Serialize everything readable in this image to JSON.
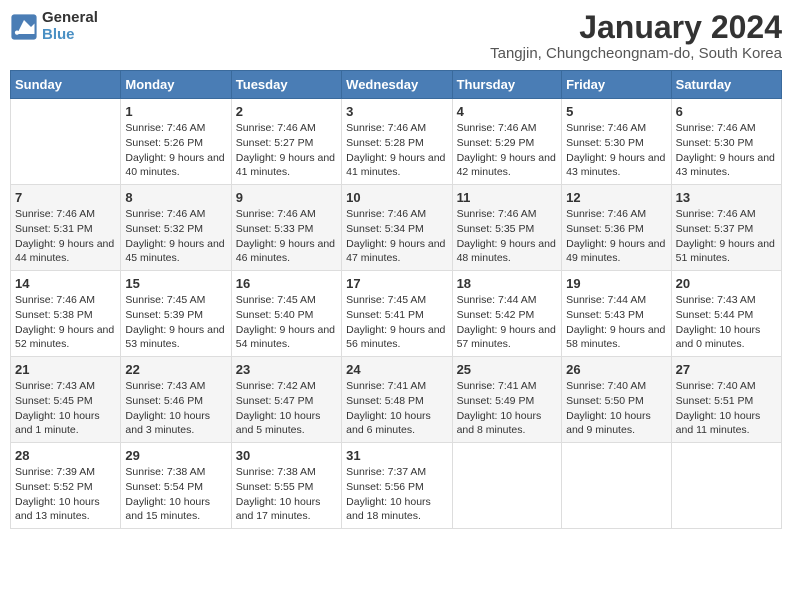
{
  "header": {
    "logo_line1": "General",
    "logo_line2": "Blue",
    "main_title": "January 2024",
    "subtitle": "Tangjin, Chungcheongnam-do, South Korea"
  },
  "days_of_week": [
    "Sunday",
    "Monday",
    "Tuesday",
    "Wednesday",
    "Thursday",
    "Friday",
    "Saturday"
  ],
  "weeks": [
    [
      {
        "day": "",
        "sunrise": "",
        "sunset": "",
        "daylight": ""
      },
      {
        "day": "1",
        "sunrise": "Sunrise: 7:46 AM",
        "sunset": "Sunset: 5:26 PM",
        "daylight": "Daylight: 9 hours and 40 minutes."
      },
      {
        "day": "2",
        "sunrise": "Sunrise: 7:46 AM",
        "sunset": "Sunset: 5:27 PM",
        "daylight": "Daylight: 9 hours and 41 minutes."
      },
      {
        "day": "3",
        "sunrise": "Sunrise: 7:46 AM",
        "sunset": "Sunset: 5:28 PM",
        "daylight": "Daylight: 9 hours and 41 minutes."
      },
      {
        "day": "4",
        "sunrise": "Sunrise: 7:46 AM",
        "sunset": "Sunset: 5:29 PM",
        "daylight": "Daylight: 9 hours and 42 minutes."
      },
      {
        "day": "5",
        "sunrise": "Sunrise: 7:46 AM",
        "sunset": "Sunset: 5:30 PM",
        "daylight": "Daylight: 9 hours and 43 minutes."
      },
      {
        "day": "6",
        "sunrise": "Sunrise: 7:46 AM",
        "sunset": "Sunset: 5:30 PM",
        "daylight": "Daylight: 9 hours and 43 minutes."
      }
    ],
    [
      {
        "day": "7",
        "sunrise": "Sunrise: 7:46 AM",
        "sunset": "Sunset: 5:31 PM",
        "daylight": "Daylight: 9 hours and 44 minutes."
      },
      {
        "day": "8",
        "sunrise": "Sunrise: 7:46 AM",
        "sunset": "Sunset: 5:32 PM",
        "daylight": "Daylight: 9 hours and 45 minutes."
      },
      {
        "day": "9",
        "sunrise": "Sunrise: 7:46 AM",
        "sunset": "Sunset: 5:33 PM",
        "daylight": "Daylight: 9 hours and 46 minutes."
      },
      {
        "day": "10",
        "sunrise": "Sunrise: 7:46 AM",
        "sunset": "Sunset: 5:34 PM",
        "daylight": "Daylight: 9 hours and 47 minutes."
      },
      {
        "day": "11",
        "sunrise": "Sunrise: 7:46 AM",
        "sunset": "Sunset: 5:35 PM",
        "daylight": "Daylight: 9 hours and 48 minutes."
      },
      {
        "day": "12",
        "sunrise": "Sunrise: 7:46 AM",
        "sunset": "Sunset: 5:36 PM",
        "daylight": "Daylight: 9 hours and 49 minutes."
      },
      {
        "day": "13",
        "sunrise": "Sunrise: 7:46 AM",
        "sunset": "Sunset: 5:37 PM",
        "daylight": "Daylight: 9 hours and 51 minutes."
      }
    ],
    [
      {
        "day": "14",
        "sunrise": "Sunrise: 7:46 AM",
        "sunset": "Sunset: 5:38 PM",
        "daylight": "Daylight: 9 hours and 52 minutes."
      },
      {
        "day": "15",
        "sunrise": "Sunrise: 7:45 AM",
        "sunset": "Sunset: 5:39 PM",
        "daylight": "Daylight: 9 hours and 53 minutes."
      },
      {
        "day": "16",
        "sunrise": "Sunrise: 7:45 AM",
        "sunset": "Sunset: 5:40 PM",
        "daylight": "Daylight: 9 hours and 54 minutes."
      },
      {
        "day": "17",
        "sunrise": "Sunrise: 7:45 AM",
        "sunset": "Sunset: 5:41 PM",
        "daylight": "Daylight: 9 hours and 56 minutes."
      },
      {
        "day": "18",
        "sunrise": "Sunrise: 7:44 AM",
        "sunset": "Sunset: 5:42 PM",
        "daylight": "Daylight: 9 hours and 57 minutes."
      },
      {
        "day": "19",
        "sunrise": "Sunrise: 7:44 AM",
        "sunset": "Sunset: 5:43 PM",
        "daylight": "Daylight: 9 hours and 58 minutes."
      },
      {
        "day": "20",
        "sunrise": "Sunrise: 7:43 AM",
        "sunset": "Sunset: 5:44 PM",
        "daylight": "Daylight: 10 hours and 0 minutes."
      }
    ],
    [
      {
        "day": "21",
        "sunrise": "Sunrise: 7:43 AM",
        "sunset": "Sunset: 5:45 PM",
        "daylight": "Daylight: 10 hours and 1 minute."
      },
      {
        "day": "22",
        "sunrise": "Sunrise: 7:43 AM",
        "sunset": "Sunset: 5:46 PM",
        "daylight": "Daylight: 10 hours and 3 minutes."
      },
      {
        "day": "23",
        "sunrise": "Sunrise: 7:42 AM",
        "sunset": "Sunset: 5:47 PM",
        "daylight": "Daylight: 10 hours and 5 minutes."
      },
      {
        "day": "24",
        "sunrise": "Sunrise: 7:41 AM",
        "sunset": "Sunset: 5:48 PM",
        "daylight": "Daylight: 10 hours and 6 minutes."
      },
      {
        "day": "25",
        "sunrise": "Sunrise: 7:41 AM",
        "sunset": "Sunset: 5:49 PM",
        "daylight": "Daylight: 10 hours and 8 minutes."
      },
      {
        "day": "26",
        "sunrise": "Sunrise: 7:40 AM",
        "sunset": "Sunset: 5:50 PM",
        "daylight": "Daylight: 10 hours and 9 minutes."
      },
      {
        "day": "27",
        "sunrise": "Sunrise: 7:40 AM",
        "sunset": "Sunset: 5:51 PM",
        "daylight": "Daylight: 10 hours and 11 minutes."
      }
    ],
    [
      {
        "day": "28",
        "sunrise": "Sunrise: 7:39 AM",
        "sunset": "Sunset: 5:52 PM",
        "daylight": "Daylight: 10 hours and 13 minutes."
      },
      {
        "day": "29",
        "sunrise": "Sunrise: 7:38 AM",
        "sunset": "Sunset: 5:54 PM",
        "daylight": "Daylight: 10 hours and 15 minutes."
      },
      {
        "day": "30",
        "sunrise": "Sunrise: 7:38 AM",
        "sunset": "Sunset: 5:55 PM",
        "daylight": "Daylight: 10 hours and 17 minutes."
      },
      {
        "day": "31",
        "sunrise": "Sunrise: 7:37 AM",
        "sunset": "Sunset: 5:56 PM",
        "daylight": "Daylight: 10 hours and 18 minutes."
      },
      {
        "day": "",
        "sunrise": "",
        "sunset": "",
        "daylight": ""
      },
      {
        "day": "",
        "sunrise": "",
        "sunset": "",
        "daylight": ""
      },
      {
        "day": "",
        "sunrise": "",
        "sunset": "",
        "daylight": ""
      }
    ]
  ]
}
